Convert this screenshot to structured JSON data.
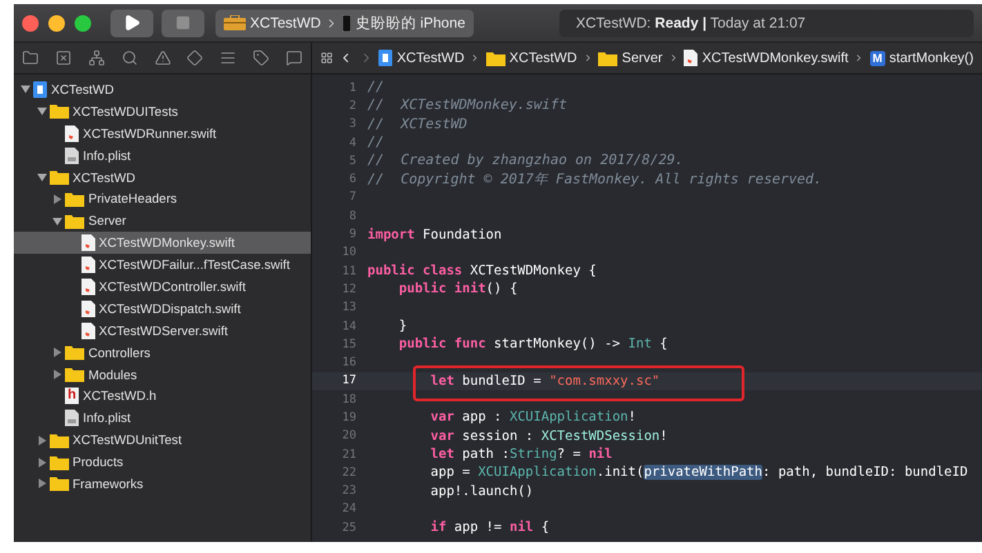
{
  "toolbar": {
    "scheme": "XCTestWD",
    "destination": "史盼盼的 iPhone",
    "status": "XCTestWD: **Ready |** Today at 21:07"
  },
  "navigator_tabs": [
    {
      "kind": "files"
    },
    {
      "kind": "source-control"
    },
    {
      "kind": "symbols"
    },
    {
      "kind": "search"
    },
    {
      "kind": "issues"
    },
    {
      "kind": "tests"
    },
    {
      "kind": "debug"
    },
    {
      "kind": "breakpoints"
    },
    {
      "kind": "reports"
    }
  ],
  "jump_bar": [
    {
      "kind": "project",
      "label": "XCTestWD"
    },
    {
      "kind": "folder",
      "label": "XCTestWD"
    },
    {
      "kind": "folder",
      "label": "Server"
    },
    {
      "kind": "swift",
      "label": "XCTestWDMonkey.swift"
    },
    {
      "kind": "method",
      "label": "startMonkey()",
      "icon_letter": "M"
    }
  ],
  "tree": [
    {
      "label": "XCTestWD",
      "kind": "project",
      "expanded": true,
      "selected": false,
      "children": [
        {
          "label": "XCTestWDUITests",
          "kind": "folder",
          "expanded": true,
          "selected": false,
          "children": [
            {
              "label": "XCTestWDRunner.swift",
              "kind": "swift",
              "selected": false
            },
            {
              "label": "Info.plist",
              "kind": "plist",
              "selected": false
            }
          ]
        },
        {
          "label": "XCTestWD",
          "kind": "folder",
          "expanded": true,
          "selected": false,
          "children": [
            {
              "label": "PrivateHeaders",
              "kind": "folder",
              "expanded": false,
              "selected": false
            },
            {
              "label": "Server",
              "kind": "folder",
              "expanded": true,
              "selected": false,
              "children": [
                {
                  "label": "XCTestWDMonkey.swift",
                  "kind": "swift",
                  "selected": true
                },
                {
                  "label": "XCTestWDFailur...fTestCase.swift",
                  "kind": "swift",
                  "selected": false
                },
                {
                  "label": "XCTestWDController.swift",
                  "kind": "swift",
                  "selected": false
                },
                {
                  "label": "XCTestWDDispatch.swift",
                  "kind": "swift",
                  "selected": false
                },
                {
                  "label": "XCTestWDServer.swift",
                  "kind": "swift",
                  "selected": false
                }
              ]
            },
            {
              "label": "Controllers",
              "kind": "folder",
              "expanded": false,
              "selected": false
            },
            {
              "label": "Modules",
              "kind": "folder",
              "expanded": false,
              "selected": false
            },
            {
              "label": "XCTestWD.h",
              "kind": "header",
              "icon_letter": "h",
              "selected": false
            },
            {
              "label": "Info.plist",
              "kind": "plist",
              "selected": false
            }
          ]
        },
        {
          "label": "XCTestWDUnitTest",
          "kind": "folder",
          "expanded": false,
          "selected": false
        },
        {
          "label": "Products",
          "kind": "folder",
          "expanded": false,
          "selected": false
        },
        {
          "label": "Frameworks",
          "kind": "folder",
          "expanded": false,
          "selected": false
        }
      ]
    }
  ],
  "code_lines": [
    {
      "n": "1",
      "current": false,
      "boxed": false,
      "tokens": [
        {
          "kind": "comment",
          "text": "//"
        }
      ]
    },
    {
      "n": "2",
      "current": false,
      "boxed": false,
      "tokens": [
        {
          "kind": "comment",
          "text": "//  XCTestWDMonkey.swift"
        }
      ]
    },
    {
      "n": "3",
      "current": false,
      "boxed": false,
      "tokens": [
        {
          "kind": "comment",
          "text": "//  XCTestWD"
        }
      ]
    },
    {
      "n": "4",
      "current": false,
      "boxed": false,
      "tokens": [
        {
          "kind": "comment",
          "text": "//"
        }
      ]
    },
    {
      "n": "5",
      "current": false,
      "boxed": false,
      "tokens": [
        {
          "kind": "comment",
          "text": "//  Created by zhangzhao on 2017/8/29."
        }
      ]
    },
    {
      "n": "6",
      "current": false,
      "boxed": false,
      "tokens": [
        {
          "kind": "comment",
          "text": "//  Copyright © 2017年 FastMonkey. All rights reserved."
        }
      ]
    },
    {
      "n": "7",
      "current": false,
      "boxed": false
    },
    {
      "n": "8",
      "current": false,
      "boxed": false
    },
    {
      "n": "9",
      "current": false,
      "boxed": false,
      "tokens": [
        {
          "kind": "keyword",
          "text": "import"
        },
        {
          "kind": "plain",
          "text": " Foundation"
        }
      ]
    },
    {
      "n": "10",
      "current": false,
      "boxed": false
    },
    {
      "n": "11",
      "current": false,
      "boxed": false,
      "tokens": [
        {
          "kind": "keyword",
          "text": "public class"
        },
        {
          "kind": "plain",
          "text": " XCTestWDMonkey {"
        }
      ]
    },
    {
      "n": "12",
      "current": false,
      "boxed": false,
      "tokens": [
        {
          "kind": "keyword",
          "text": "    public init"
        },
        {
          "kind": "plain",
          "text": "() {"
        }
      ]
    },
    {
      "n": "13",
      "current": false,
      "boxed": false
    },
    {
      "n": "14",
      "current": false,
      "boxed": false,
      "tokens": [
        {
          "kind": "plain",
          "text": "    }"
        }
      ]
    },
    {
      "n": "15",
      "current": false,
      "boxed": false,
      "tokens": [
        {
          "kind": "keyword",
          "text": "    public func"
        },
        {
          "kind": "plain",
          "text": " startMonkey() -> "
        },
        {
          "kind": "type",
          "text": "Int"
        },
        {
          "kind": "plain",
          "text": " {"
        }
      ]
    },
    {
      "n": "16",
      "current": false,
      "boxed": false
    },
    {
      "n": "17",
      "current": true,
      "boxed": true,
      "tokens": [
        {
          "kind": "keyword",
          "text": "        let"
        },
        {
          "kind": "plain",
          "text": " bundleID = "
        },
        {
          "kind": "string",
          "text": "\"com.smxxy.sc\""
        }
      ]
    },
    {
      "n": "18",
      "current": false,
      "boxed": false
    },
    {
      "n": "19",
      "current": false,
      "boxed": false,
      "tokens": [
        {
          "kind": "keyword",
          "text": "        var"
        },
        {
          "kind": "plain",
          "text": " app : "
        },
        {
          "kind": "type",
          "text": "XCUIApplication"
        },
        {
          "kind": "plain",
          "text": "!"
        }
      ]
    },
    {
      "n": "20",
      "current": false,
      "boxed": false,
      "tokens": [
        {
          "kind": "keyword",
          "text": "        var"
        },
        {
          "kind": "plain",
          "text": " session : "
        },
        {
          "kind": "project_type",
          "text": "XCTestWDSession"
        },
        {
          "kind": "plain",
          "text": "!"
        }
      ]
    },
    {
      "n": "21",
      "current": false,
      "boxed": false,
      "tokens": [
        {
          "kind": "keyword",
          "text": "        let"
        },
        {
          "kind": "plain",
          "text": " path :"
        },
        {
          "kind": "type",
          "text": "String"
        },
        {
          "kind": "plain",
          "text": "? = "
        },
        {
          "kind": "keyword",
          "text": "nil"
        }
      ]
    },
    {
      "n": "22",
      "current": false,
      "boxed": false,
      "tokens": [
        {
          "kind": "plain",
          "text": "        app = "
        },
        {
          "kind": "type",
          "text": "XCUIApplication"
        },
        {
          "kind": "plain",
          "text": ".init("
        },
        {
          "kind": "match",
          "text": "privateWithPath"
        },
        {
          "kind": "plain",
          "text": ": path, bundleID: bundleID"
        }
      ]
    },
    {
      "n": "23",
      "current": false,
      "boxed": false,
      "tokens": [
        {
          "kind": "plain",
          "text": "        app!.launch()"
        }
      ]
    },
    {
      "n": "24",
      "current": false,
      "boxed": false
    },
    {
      "n": "25",
      "current": false,
      "boxed": false,
      "tokens": [
        {
          "kind": "keyword",
          "text": "        if"
        },
        {
          "kind": "plain",
          "text": " app != "
        },
        {
          "kind": "keyword",
          "text": "nil"
        },
        {
          "kind": "plain",
          "text": " {"
        }
      ]
    }
  ]
}
